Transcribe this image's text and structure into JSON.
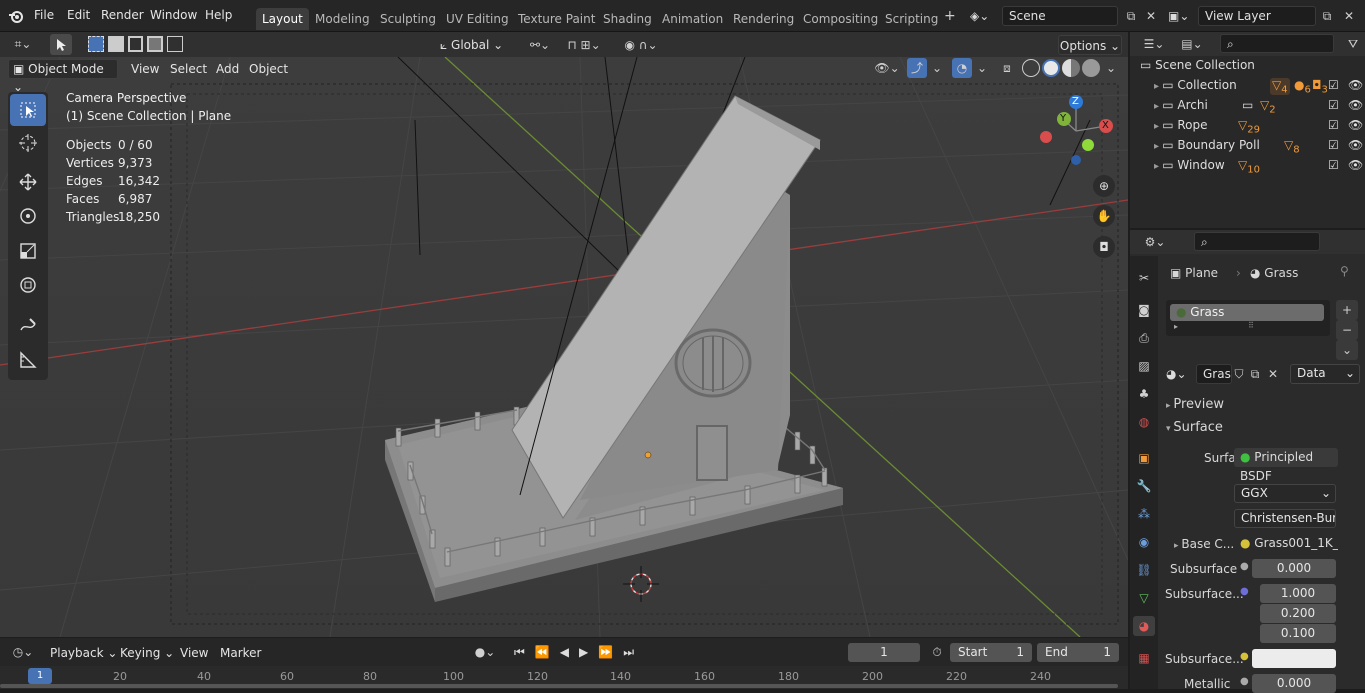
{
  "menus": [
    "File",
    "Edit",
    "Render",
    "Window",
    "Help"
  ],
  "workspaces": [
    "Layout",
    "Modeling",
    "Sculpting",
    "UV Editing",
    "Texture Paint",
    "Shading",
    "Animation",
    "Rendering",
    "Compositing",
    "Scripting"
  ],
  "scene": "Scene",
  "view_layer": "View Layer",
  "header": {
    "orientation": "Global",
    "options": "Options",
    "mode": "Object Mode",
    "view": "View",
    "select": "Select",
    "add": "Add",
    "object": "Object"
  },
  "overlay": {
    "camera": "Camera Perspective",
    "collection": "(1) Scene Collection | Plane"
  },
  "stats": [
    {
      "label": "Objects",
      "value": "0 / 60"
    },
    {
      "label": "Vertices",
      "value": "9,373"
    },
    {
      "label": "Edges",
      "value": "16,342"
    },
    {
      "label": "Faces",
      "value": "6,987"
    },
    {
      "label": "Triangles",
      "value": "18,250"
    }
  ],
  "gizmo": {
    "z": "Z",
    "y": "Y",
    "x": "X"
  },
  "outliner": {
    "root": "Scene Collection",
    "items": [
      {
        "name": "Collection",
        "count": "4"
      },
      {
        "name": "Archi",
        "count": "2"
      },
      {
        "name": "Rope",
        "count": "29"
      },
      {
        "name": "Boundary Poll",
        "count": "8"
      },
      {
        "name": "Window",
        "count": "10"
      }
    ],
    "collection_badges": [
      "6",
      "3"
    ]
  },
  "props": {
    "object": "Plane",
    "material": "Grass",
    "slot": "Grass",
    "mat_field": "Gras",
    "link": "Data",
    "preview": "Preview",
    "surface_panel": "Surface",
    "surface_label": "Surface",
    "surface_value": "Principled BSDF",
    "dist": "GGX",
    "sss_method": "Christensen-Bur...",
    "base_color_label": "Base C...",
    "base_color_value": "Grass001_1K_...",
    "subsurface_label": "Subsurface",
    "subsurface_value": "0.000",
    "radius_label": "Subsurface...",
    "radius": [
      "1.000",
      "0.200",
      "0.100"
    ],
    "sss_color_label": "Subsurface...",
    "metallic_label": "Metallic",
    "metallic_value": "0.000"
  },
  "timeline": {
    "playback": "Playback",
    "keying": "Keying",
    "view": "View",
    "marker": "Marker",
    "frame": "1",
    "start_label": "Start",
    "start": "1",
    "end_label": "End",
    "end": "1",
    "ruler": [
      "1",
      "20",
      "40",
      "60",
      "80",
      "100",
      "120",
      "140",
      "160",
      "180",
      "200",
      "220",
      "240"
    ]
  },
  "colors": {
    "accent": "#4772b3",
    "active_tab": "#3d3d3d",
    "viewport": "#3c3c3c",
    "x_axis": "#d94d4d",
    "y_axis": "#7fb339",
    "z_axis": "#2e7ad9"
  }
}
